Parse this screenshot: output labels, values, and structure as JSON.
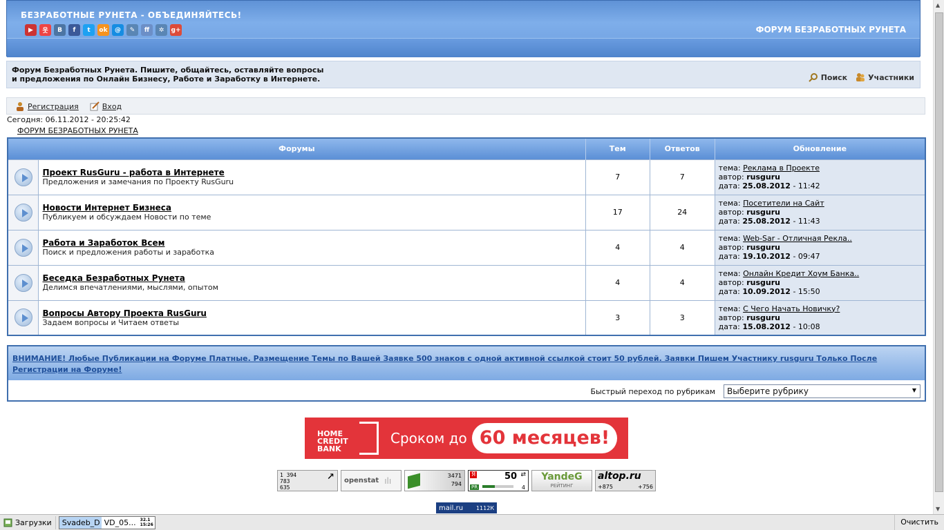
{
  "header": {
    "title": "БЕЗРАБОТНЫЕ РУНЕТА - ОБЪЕДИНЯЙТЕСЬ!",
    "right_title": "ФОРУМ БЕЗРАБОТНЫХ РУНЕТА",
    "social_icons": [
      {
        "name": "youtube-icon",
        "glyph": "▶",
        "color": "#c33"
      },
      {
        "name": "person-icon",
        "glyph": "웃",
        "color": "#e44"
      },
      {
        "name": "vk-icon",
        "glyph": "B",
        "color": "#4c75a3"
      },
      {
        "name": "facebook-icon",
        "glyph": "f",
        "color": "#3b5998"
      },
      {
        "name": "twitter-icon",
        "glyph": "t",
        "color": "#1da1f2"
      },
      {
        "name": "odnoklassniki-icon",
        "glyph": "ok",
        "color": "#f7931e"
      },
      {
        "name": "mailru-icon",
        "glyph": "@",
        "color": "#168de2"
      },
      {
        "name": "livejournal-icon",
        "glyph": "✎",
        "color": "#5a86b4"
      },
      {
        "name": "friendfeed-icon",
        "glyph": "ff",
        "color": "#6c8fc7"
      },
      {
        "name": "settings-icon",
        "glyph": "✲",
        "color": "#5a86b4"
      },
      {
        "name": "google-plus-icon",
        "glyph": "g+",
        "color": "#dd4b39"
      }
    ]
  },
  "info": {
    "line1": "Форум Безработных Рунета. Пишите, общайтесь, оставляйте вопросы",
    "line2": "и предложения по Онлайн Бизнесу, Работе и Заработку в Интернете.",
    "search": "Поиск",
    "members": "Участники"
  },
  "login": {
    "register": "Регистрация",
    "login": "Вход"
  },
  "today": "Сегодня: 06.11.2012 - 20:25:42",
  "breadcrumb": "ФОРУМ БЕЗРАБОТНЫХ РУНЕТА",
  "table": {
    "headers": {
      "forums": "Форумы",
      "topics": "Тем",
      "replies": "Ответов",
      "updated": "Обновление"
    },
    "labels": {
      "topic": "тема: ",
      "author": "автор: ",
      "date": "дата: "
    },
    "rows": [
      {
        "name": "Проект RusGuru - работа в Интернете",
        "desc": "Предложения и замечания по Проекту RusGuru",
        "topics": "7",
        "replies": "7",
        "last_topic": "Реклама в Проекте",
        "author": "rusguru",
        "date": "25.08.2012",
        "time": " - 11:42"
      },
      {
        "name": "Новости Интернет Бизнеса",
        "desc": "Публикуем и обсуждаем Новости по теме",
        "topics": "17",
        "replies": "24",
        "last_topic": "Посетители на Сайт",
        "author": "rusguru",
        "date": "25.08.2012",
        "time": " - 11:43"
      },
      {
        "name": "Работа и Заработок Всем",
        "desc": "Поиск и предложения работы и заработка",
        "topics": "4",
        "replies": "4",
        "last_topic": "Web-Sar - Отличная Рекла..",
        "author": "rusguru",
        "date": "19.10.2012",
        "time": " - 09:47"
      },
      {
        "name": "Беседка Безработных Рунета",
        "desc": "Делимся впечатлениями, мыслями, опытом",
        "topics": "4",
        "replies": "4",
        "last_topic": "Онлайн Кредит Хоум Банка..",
        "author": "rusguru",
        "date": "10.09.2012",
        "time": " - 15:50"
      },
      {
        "name": "Вопросы Автору Проекта RusGuru",
        "desc": "Задаем вопросы и Читаем ответы",
        "topics": "3",
        "replies": "3",
        "last_topic": "С Чего Начать Новичку?",
        "author": "rusguru",
        "date": "15.08.2012",
        "time": " - 10:08"
      }
    ]
  },
  "notice": {
    "text": "ВНИМАНИЕ! Любые Публикации на Форуме Платные. Размещение Темы по Вашей Заявке 500 знаков с одной активной ссылкой стоит 50 рублей. Заявки Пишем Участнику rusguru Только После Регистрации на Форуме!",
    "jump_label": "Быстрый переход по рубрикам",
    "select_value": "Выберите рубрику"
  },
  "banner": {
    "bank_line1": "HOME",
    "bank_line2": "CREDIT",
    "bank_line3": "BANK",
    "term_text": "Сроком до",
    "months_text": "60 месяцев!"
  },
  "counters": {
    "liveinternet": [
      "1 394",
      "783",
      "635"
    ],
    "openstat": "openstat",
    "c3_top": "3471",
    "c3_bottom": "794",
    "yandex_ci": "50",
    "yandex_ya": "Я",
    "yandex_pr": "PR",
    "yandex_pr_value": "4",
    "yandeg": "YandeG",
    "yandeg_sub": "РЕЙТИНГ",
    "altop": "altop.ru",
    "altop_a": "+875",
    "altop_b": "+756",
    "mailru": "mail.ru",
    "mailru_count": "1112К"
  },
  "taskbar": {
    "downloads": "Загрузки",
    "file_hl": "Svadeb_D",
    "file_rest": "VD_05...",
    "size_top": "32.1",
    "size_bottom": "15:26",
    "clear": "Очистить"
  }
}
